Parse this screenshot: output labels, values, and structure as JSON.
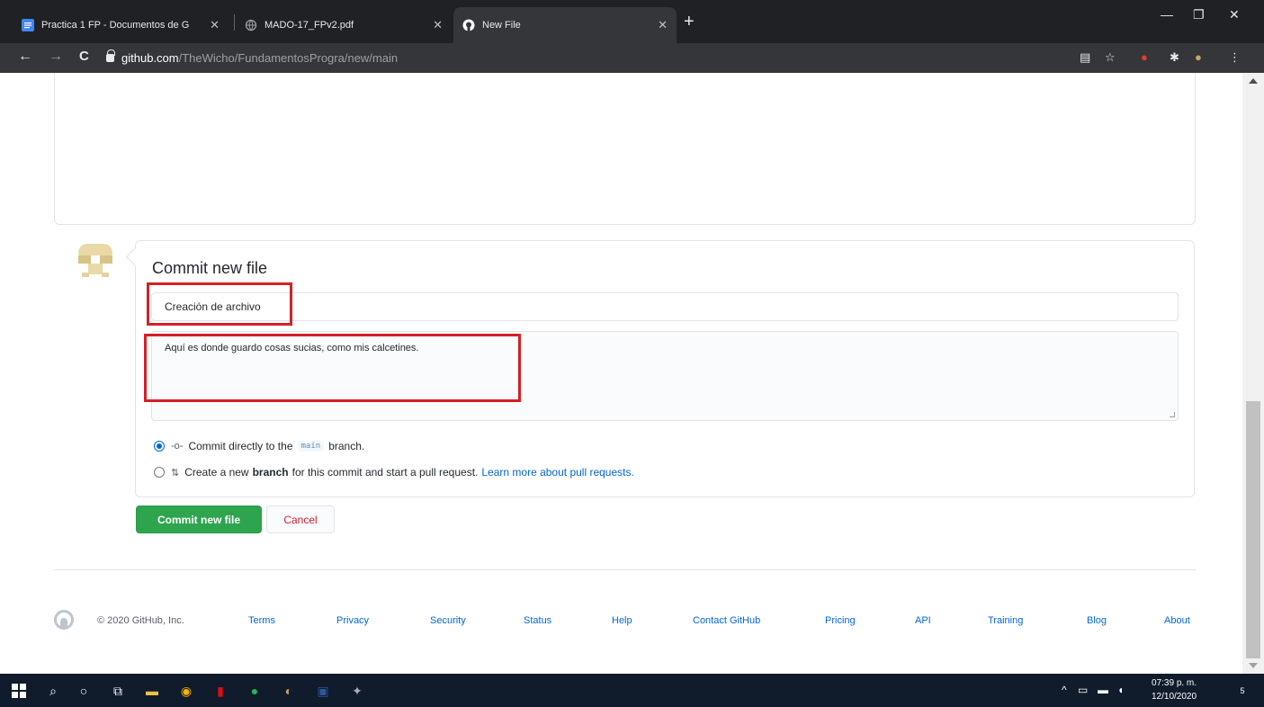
{
  "browser": {
    "tabs": [
      {
        "title": "Practica 1 FP - Documentos de G",
        "icon": "google-docs-icon",
        "active": false
      },
      {
        "title": "MADO-17_FPv2.pdf",
        "icon": "globe-icon",
        "active": false
      },
      {
        "title": "New File",
        "icon": "github-icon",
        "active": true
      }
    ],
    "url_host": "github.com",
    "url_path": "/TheWicho/FundamentosProgra/new/main"
  },
  "commit": {
    "title": "Commit new file",
    "summary_value": "Creación de archivo",
    "description_value": "Aquí es donde guardo cosas sucias, como mis calcetines.",
    "option_direct_prefix": "Commit directly to the",
    "option_direct_branch": "main",
    "option_direct_suffix": "branch.",
    "option_new_prefix": "Create a new",
    "option_new_bold": "branch",
    "option_new_suffix": "for this commit and start a pull request.",
    "option_new_link": "Learn more about pull requests.",
    "commit_button": "Commit new file",
    "cancel_button": "Cancel"
  },
  "footer": {
    "copyright": "© 2020 GitHub, Inc.",
    "links": [
      "Terms",
      "Privacy",
      "Security",
      "Status",
      "Help",
      "Contact GitHub",
      "Pricing",
      "API",
      "Training",
      "Blog",
      "About"
    ]
  },
  "taskbar": {
    "time": "07:39 p. m.",
    "date": "12/10/2020",
    "notifications": "5"
  },
  "colors": {
    "primary_button": "#2ea44f",
    "cancel_text": "#cb2431",
    "link": "#0366d6",
    "highlight": "#d42025"
  }
}
